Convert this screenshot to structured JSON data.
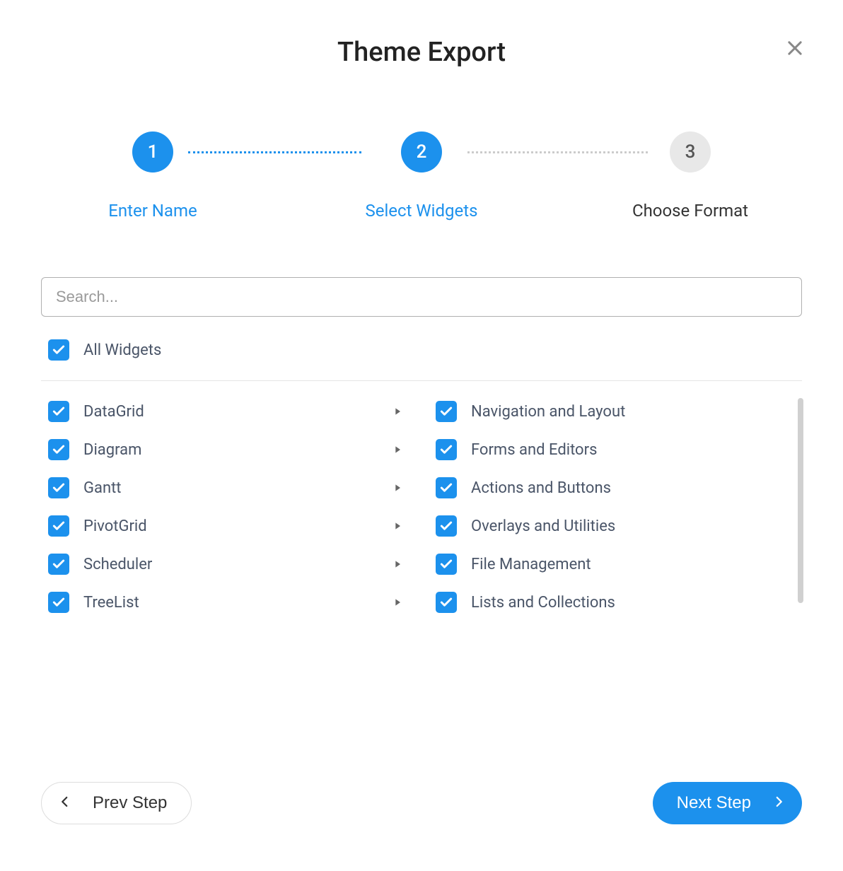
{
  "title": "Theme Export",
  "stepper": {
    "steps": [
      {
        "num": "1",
        "label": "Enter Name",
        "active": true
      },
      {
        "num": "2",
        "label": "Select Widgets",
        "active": true
      },
      {
        "num": "3",
        "label": "Choose Format",
        "active": false
      }
    ]
  },
  "search": {
    "placeholder": "Search..."
  },
  "all_widgets_label": "All Widgets",
  "widgets_left": [
    {
      "label": "DataGrid",
      "checked": true,
      "expandable": true
    },
    {
      "label": "Diagram",
      "checked": true,
      "expandable": true
    },
    {
      "label": "Gantt",
      "checked": true,
      "expandable": true
    },
    {
      "label": "PivotGrid",
      "checked": true,
      "expandable": true
    },
    {
      "label": "Scheduler",
      "checked": true,
      "expandable": true
    },
    {
      "label": "TreeList",
      "checked": true,
      "expandable": true
    }
  ],
  "widgets_right": [
    {
      "label": "Navigation and Layout",
      "checked": true,
      "expandable": false
    },
    {
      "label": "Forms and Editors",
      "checked": true,
      "expandable": false
    },
    {
      "label": "Actions and Buttons",
      "checked": true,
      "expandable": false
    },
    {
      "label": "Overlays and Utilities",
      "checked": true,
      "expandable": false
    },
    {
      "label": "File Management",
      "checked": true,
      "expandable": false
    },
    {
      "label": "Lists and Collections",
      "checked": true,
      "expandable": false
    }
  ],
  "footer": {
    "prev_label": "Prev Step",
    "next_label": "Next Step"
  }
}
